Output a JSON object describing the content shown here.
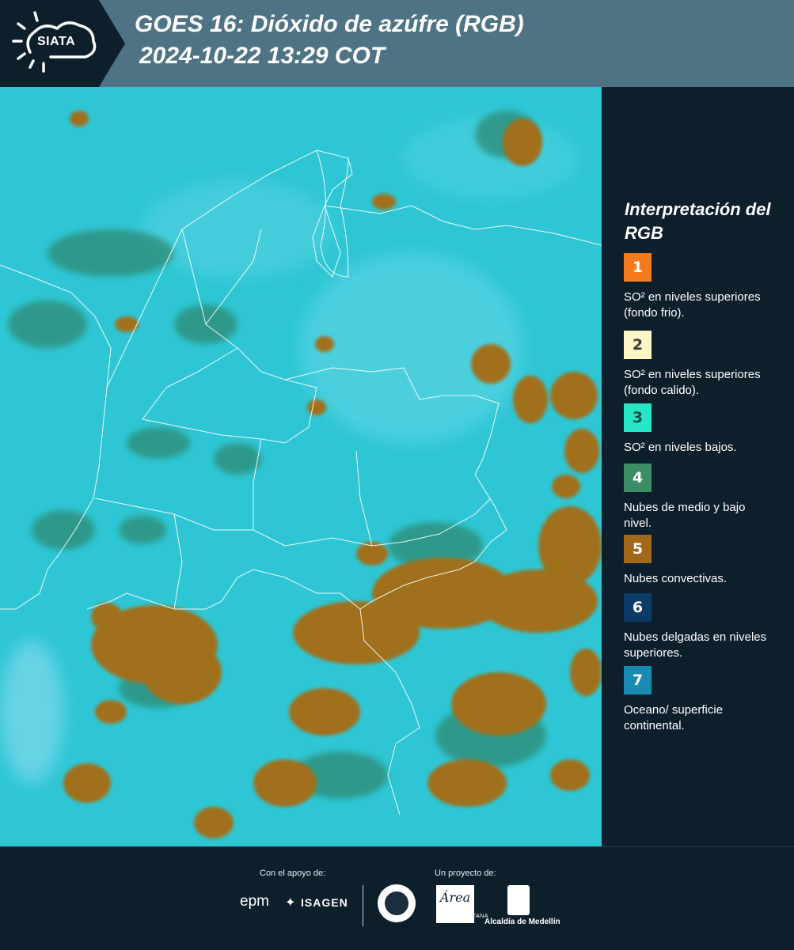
{
  "header": {
    "logo_text": "SIATA",
    "title_line1": "GOES 16: Dióxido de azúfre (RGB)",
    "title_line2": "2024-10-22 13:29 COT"
  },
  "legend": {
    "title": "Interpretación del RGB",
    "items": [
      {
        "number": "1",
        "color": "#f47b1e",
        "text": "SO² en niveles superiores (fondo frio)."
      },
      {
        "number": "2",
        "color": "#fdf5c5",
        "text": "SO² en niveles superiores (fondo calido)."
      },
      {
        "number": "3",
        "color": "#27e6c5",
        "text": "SO² en niveles bajos."
      },
      {
        "number": "4",
        "color": "#3a8d64",
        "text": "Nubes de medio y bajo nivel."
      },
      {
        "number": "5",
        "color": "#a2681a",
        "text": "Nubes convectivas."
      },
      {
        "number": "6",
        "color": "#0e3a68",
        "text": "Nubes delgadas en niveles superiores."
      },
      {
        "number": "7",
        "color": "#1a8ab0",
        "text": "Oceano/ superficie continental."
      }
    ]
  },
  "footer": {
    "support_label": "Con el apoyo de:",
    "project_label": "Un proyecto de:",
    "sponsor_epm": "epm",
    "sponsor_isagen": "ISAGEN",
    "partner_area": "Área",
    "partner_area_sub": "METROPOLITANA",
    "partner_alcaldia": "Alcaldía de Medellín"
  },
  "map": {
    "base_color": "#2ec6d4",
    "cloud_color": "#a0701e"
  }
}
